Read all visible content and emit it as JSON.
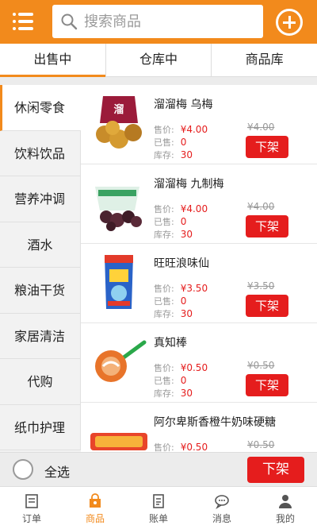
{
  "header": {
    "search_placeholder": "搜索商品"
  },
  "tabs": [
    "出售中",
    "仓库中",
    "商品库"
  ],
  "categories": [
    "休闲零食",
    "饮料饮品",
    "营养冲调",
    "酒水",
    "粮油干货",
    "家居清洁",
    "代购",
    "纸巾护理"
  ],
  "field_labels": {
    "price": "售价:",
    "sold": "已售:",
    "stock": "库存:"
  },
  "products": [
    {
      "name": "溜溜梅 乌梅",
      "price": "¥4.00",
      "orig_price": "¥4.00",
      "sold": "0",
      "stock": "30",
      "button": "下架"
    },
    {
      "name": "溜溜梅 九制梅",
      "price": "¥4.00",
      "orig_price": "¥4.00",
      "sold": "0",
      "stock": "30",
      "button": "下架"
    },
    {
      "name": "旺旺浪味仙",
      "price": "¥3.50",
      "orig_price": "¥3.50",
      "sold": "0",
      "stock": "30",
      "button": "下架"
    },
    {
      "name": "真知棒",
      "price": "¥0.50",
      "orig_price": "¥0.50",
      "sold": "0",
      "stock": "30",
      "button": "下架"
    },
    {
      "name": "阿尔卑斯香橙牛奶味硬糖",
      "price": "¥0.50",
      "orig_price": "¥0.50",
      "sold": "",
      "stock": "",
      "button": ""
    }
  ],
  "select_bar": {
    "label": "全选",
    "button": "下架"
  },
  "nav": [
    "订单",
    "商品",
    "账单",
    "消息",
    "我的"
  ],
  "colors": {
    "brand": "#f28a1c",
    "price": "#e51d1d",
    "button": "#e51d1d"
  }
}
